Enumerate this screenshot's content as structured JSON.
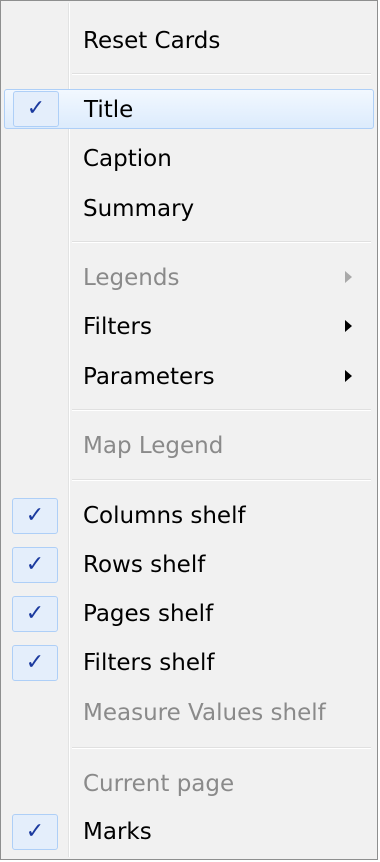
{
  "menu": {
    "items": [
      {
        "label": "Reset Cards",
        "checked": false,
        "enabled": true,
        "submenu": false
      },
      {
        "label": "Title",
        "checked": true,
        "enabled": true,
        "submenu": false,
        "highlighted": true
      },
      {
        "label": "Caption",
        "checked": false,
        "enabled": true,
        "submenu": false
      },
      {
        "label": "Summary",
        "checked": false,
        "enabled": true,
        "submenu": false
      },
      {
        "label": "Legends",
        "checked": false,
        "enabled": false,
        "submenu": true
      },
      {
        "label": "Filters",
        "checked": false,
        "enabled": true,
        "submenu": true
      },
      {
        "label": "Parameters",
        "checked": false,
        "enabled": true,
        "submenu": true
      },
      {
        "label": "Map Legend",
        "checked": false,
        "enabled": false,
        "submenu": false
      },
      {
        "label": "Columns shelf",
        "checked": true,
        "enabled": true,
        "submenu": false
      },
      {
        "label": "Rows shelf",
        "checked": true,
        "enabled": true,
        "submenu": false
      },
      {
        "label": "Pages shelf",
        "checked": true,
        "enabled": true,
        "submenu": false
      },
      {
        "label": "Filters shelf",
        "checked": true,
        "enabled": true,
        "submenu": false
      },
      {
        "label": "Measure Values shelf",
        "checked": false,
        "enabled": false,
        "submenu": false
      },
      {
        "label": "Current page",
        "checked": false,
        "enabled": false,
        "submenu": false
      },
      {
        "label": "Marks",
        "checked": true,
        "enabled": true,
        "submenu": false
      }
    ],
    "check_glyph": "✓",
    "colors": {
      "check": "#1b3a9e",
      "highlight_border": "#aecff7",
      "disabled_text": "#8a8a8a"
    }
  }
}
